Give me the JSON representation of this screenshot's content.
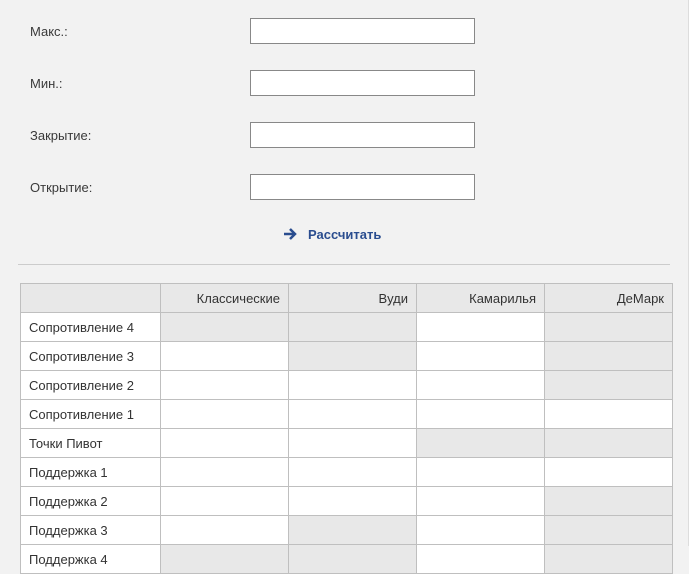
{
  "form": {
    "max_label": "Макс.:",
    "min_label": "Мин.:",
    "close_label": "Закрытие:",
    "open_label": "Открытие:",
    "max_value": "",
    "min_value": "",
    "close_value": "",
    "open_value": "",
    "submit_label": "Рассчитать"
  },
  "table": {
    "headers": {
      "classic": "Классические",
      "woodie": "Вуди",
      "camarilla": "Камарилья",
      "demark": "ДеМарк"
    },
    "rows": [
      {
        "label": "Сопротивление 4",
        "classic": "",
        "woodie": "",
        "camarilla": "",
        "demark": "",
        "shade": {
          "classic": true,
          "woodie": true,
          "camarilla": false,
          "demark": true
        }
      },
      {
        "label": "Сопротивление 3",
        "classic": "",
        "woodie": "",
        "camarilla": "",
        "demark": "",
        "shade": {
          "classic": false,
          "woodie": true,
          "camarilla": false,
          "demark": true
        }
      },
      {
        "label": "Сопротивление 2",
        "classic": "",
        "woodie": "",
        "camarilla": "",
        "demark": "",
        "shade": {
          "classic": false,
          "woodie": false,
          "camarilla": false,
          "demark": true
        }
      },
      {
        "label": "Сопротивление 1",
        "classic": "",
        "woodie": "",
        "camarilla": "",
        "demark": "",
        "shade": {
          "classic": false,
          "woodie": false,
          "camarilla": false,
          "demark": false
        }
      },
      {
        "label": "Точки Пивот",
        "classic": "",
        "woodie": "",
        "camarilla": "",
        "demark": "",
        "shade": {
          "classic": false,
          "woodie": false,
          "camarilla": true,
          "demark": true
        }
      },
      {
        "label": "Поддержка 1",
        "classic": "",
        "woodie": "",
        "camarilla": "",
        "demark": "",
        "shade": {
          "classic": false,
          "woodie": false,
          "camarilla": false,
          "demark": false
        }
      },
      {
        "label": "Поддержка 2",
        "classic": "",
        "woodie": "",
        "camarilla": "",
        "demark": "",
        "shade": {
          "classic": false,
          "woodie": false,
          "camarilla": false,
          "demark": true
        }
      },
      {
        "label": "Поддержка 3",
        "classic": "",
        "woodie": "",
        "camarilla": "",
        "demark": "",
        "shade": {
          "classic": false,
          "woodie": true,
          "camarilla": false,
          "demark": true
        }
      },
      {
        "label": "Поддержка 4",
        "classic": "",
        "woodie": "",
        "camarilla": "",
        "demark": "",
        "shade": {
          "classic": true,
          "woodie": true,
          "camarilla": false,
          "demark": true
        }
      }
    ]
  }
}
